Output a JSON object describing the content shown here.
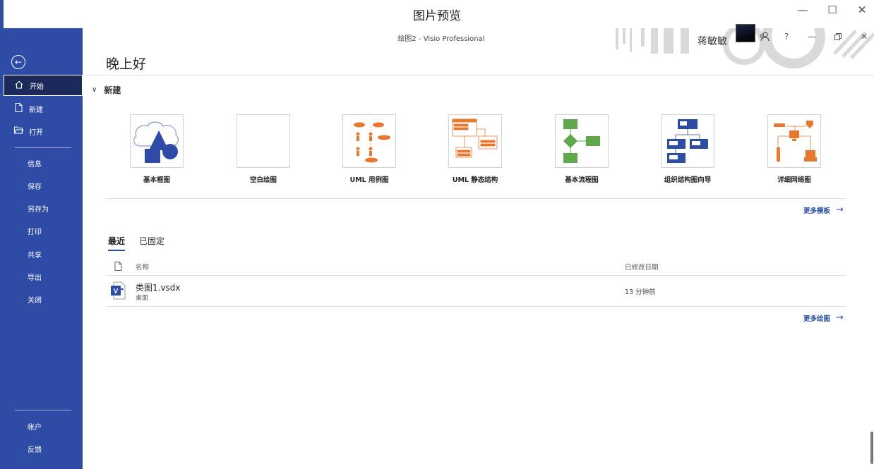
{
  "viewer": {
    "title": "图片预览"
  },
  "app": {
    "doc_title": "绘图2  -  Visio Professional",
    "user_name": "蒋敏敏"
  },
  "sidebar": {
    "items": [
      {
        "label": "开始",
        "icon": "home-icon"
      },
      {
        "label": "新建",
        "icon": "new-document-icon"
      },
      {
        "label": "打开",
        "icon": "open-folder-icon"
      },
      {
        "label": "信息"
      },
      {
        "label": "保存"
      },
      {
        "label": "另存为"
      },
      {
        "label": "打印"
      },
      {
        "label": "共享"
      },
      {
        "label": "导出"
      },
      {
        "label": "关闭"
      }
    ],
    "bottom": [
      {
        "label": "帐户"
      },
      {
        "label": "反馈"
      }
    ]
  },
  "main": {
    "greeting": "晚上好",
    "new_section": "新建",
    "templates": [
      {
        "label": "基本框图"
      },
      {
        "label": "空白绘图"
      },
      {
        "label": "UML 用例图"
      },
      {
        "label": "UML 静态结构"
      },
      {
        "label": "基本流程图"
      },
      {
        "label": "组织结构图向导"
      },
      {
        "label": "详细网络图"
      }
    ],
    "more_templates": "更多模板",
    "tabs": [
      {
        "label": "最近"
      },
      {
        "label": "已固定"
      }
    ],
    "columns": {
      "name": "名称",
      "modified": "已修改日期"
    },
    "files": [
      {
        "name": "类图1.vsdx",
        "location": "桌面",
        "modified": "13 分钟前"
      }
    ],
    "more_drawings": "更多绘图"
  },
  "colors": {
    "sidebar": "#2e4ca6",
    "accent": "#2b4ea3",
    "orange": "#e8782f",
    "green": "#5fa84a",
    "navy": "#2e4ca6"
  }
}
